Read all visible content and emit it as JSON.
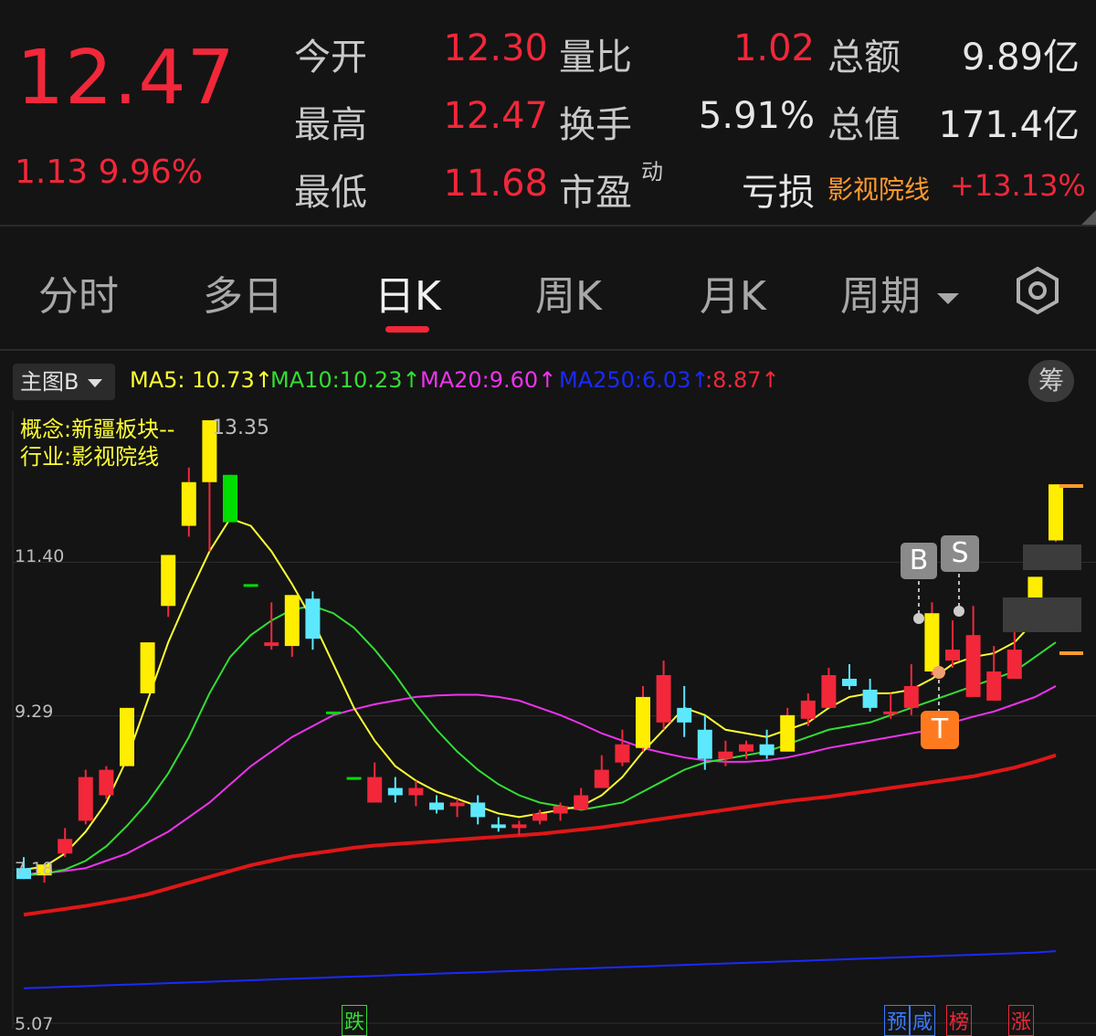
{
  "quote": {
    "price": "12.47",
    "change": "1.13 9.96%",
    "rows": [
      {
        "l1": "今开",
        "v1": "12.30",
        "l2": "量比",
        "v2": "1.02",
        "l3": "总额",
        "v3": "9.89亿"
      },
      {
        "l1": "最高",
        "v1": "12.47",
        "l2": "换手",
        "v2": "5.91%",
        "l3": "总值",
        "v3": "171.4亿"
      },
      {
        "l1": "最低",
        "v1": "11.68",
        "l2": "市盈",
        "v2": "亏损",
        "v2sup": "动",
        "l3": "影视院线",
        "v3": "+13.13%"
      }
    ]
  },
  "tabs": [
    "分时",
    "多日",
    "日K",
    "周K",
    "月K",
    "周期"
  ],
  "active_tab": "日K",
  "chart_toolbar": {
    "main_label": "主图B",
    "ma5": "MA5: 10.73↑",
    "ma10": "MA10:10.23↑",
    "ma20": "MA20:9.60↑",
    "ma250": "MA250:6.03↑",
    "extra": ":8.87↑",
    "chou": "筹"
  },
  "concept": {
    "line1": "概念:新疆板块--",
    "line2": "行业:影视院线"
  },
  "markers": {
    "high": "13.35",
    "b": "B",
    "s": "S",
    "t": "T",
    "die": "跌",
    "yu": "预",
    "xian": "咸",
    "bang": "榜",
    "zhang": "涨"
  },
  "colors": {
    "up": "#f2273a",
    "down": "#5ce8ff",
    "ma5": "#ffff33",
    "ma10": "#33dd33",
    "ma20": "#ee33ee",
    "ma250": "#1a2aff",
    "ma_red": "#e01616",
    "limit_up": "#ffee00",
    "limit_down": "#00dd00"
  },
  "chart_data": {
    "type": "candlestick",
    "ylabels": [
      "11.40",
      "9.29",
      "7.18",
      "5.07"
    ],
    "ylim": [
      5.07,
      13.35
    ],
    "candles": [
      {
        "o": 7.2,
        "h": 7.35,
        "l": 7.05,
        "c": 7.05
      },
      {
        "o": 7.1,
        "h": 7.25,
        "l": 7.0,
        "c": 7.25,
        "limit": true
      },
      {
        "o": 7.4,
        "h": 7.75,
        "l": 7.35,
        "c": 7.6
      },
      {
        "o": 7.85,
        "h": 8.55,
        "l": 7.8,
        "c": 8.45
      },
      {
        "o": 8.2,
        "h": 8.6,
        "l": 8.15,
        "c": 8.55
      },
      {
        "o": 8.6,
        "h": 9.4,
        "l": 8.6,
        "c": 9.4,
        "limit": true
      },
      {
        "o": 9.6,
        "h": 10.3,
        "l": 9.6,
        "c": 10.3,
        "limit": true
      },
      {
        "o": 10.8,
        "h": 11.5,
        "l": 10.65,
        "c": 11.5,
        "limit": true
      },
      {
        "o": 12.5,
        "h": 12.7,
        "l": 11.75,
        "c": 11.9,
        "limit": true
      },
      {
        "o": 12.5,
        "h": 13.35,
        "l": 11.55,
        "c": 13.35,
        "limit": true
      },
      {
        "o": 12.6,
        "h": 12.6,
        "l": 11.95,
        "c": 11.95,
        "fall": true
      },
      {
        "o": 11.1,
        "h": 11.1,
        "l": 11.1,
        "c": 11.1,
        "fall": true
      },
      {
        "o": 10.25,
        "h": 10.85,
        "l": 10.2,
        "c": 10.3
      },
      {
        "o": 10.25,
        "h": 10.95,
        "l": 10.1,
        "c": 10.95,
        "limit": true
      },
      {
        "o": 10.9,
        "h": 11.0,
        "l": 10.2,
        "c": 10.35
      },
      {
        "o": 9.35,
        "h": 9.35,
        "l": 9.35,
        "c": 9.35,
        "fall": true
      },
      {
        "o": 8.45,
        "h": 8.45,
        "l": 8.45,
        "c": 8.45,
        "fall": true
      },
      {
        "o": 8.1,
        "h": 8.65,
        "l": 8.1,
        "c": 8.45
      },
      {
        "o": 8.3,
        "h": 8.45,
        "l": 8.1,
        "c": 8.2
      },
      {
        "o": 8.2,
        "h": 8.4,
        "l": 8.05,
        "c": 8.3
      },
      {
        "o": 8.1,
        "h": 8.2,
        "l": 7.95,
        "c": 8.0
      },
      {
        "o": 8.05,
        "h": 8.15,
        "l": 7.9,
        "c": 8.1
      },
      {
        "o": 8.1,
        "h": 8.2,
        "l": 7.8,
        "c": 7.9
      },
      {
        "o": 7.8,
        "h": 7.9,
        "l": 7.7,
        "c": 7.75
      },
      {
        "o": 7.75,
        "h": 7.85,
        "l": 7.65,
        "c": 7.8
      },
      {
        "o": 7.85,
        "h": 8.0,
        "l": 7.8,
        "c": 7.95
      },
      {
        "o": 7.95,
        "h": 8.1,
        "l": 7.85,
        "c": 8.05
      },
      {
        "o": 8.0,
        "h": 8.3,
        "l": 8.0,
        "c": 8.2
      },
      {
        "o": 8.3,
        "h": 8.75,
        "l": 8.3,
        "c": 8.55
      },
      {
        "o": 8.65,
        "h": 9.1,
        "l": 8.6,
        "c": 8.9
      },
      {
        "o": 8.85,
        "h": 9.7,
        "l": 8.8,
        "c": 9.55,
        "limit": true
      },
      {
        "o": 9.2,
        "h": 10.05,
        "l": 9.1,
        "c": 9.85
      },
      {
        "o": 9.4,
        "h": 9.7,
        "l": 9.0,
        "c": 9.2
      },
      {
        "o": 9.1,
        "h": 9.3,
        "l": 8.55,
        "c": 8.7
      },
      {
        "o": 8.7,
        "h": 8.95,
        "l": 8.6,
        "c": 8.8
      },
      {
        "o": 8.8,
        "h": 8.95,
        "l": 8.7,
        "c": 8.9
      },
      {
        "o": 8.9,
        "h": 9.1,
        "l": 8.7,
        "c": 8.75
      },
      {
        "o": 8.8,
        "h": 9.4,
        "l": 8.8,
        "c": 9.3,
        "limit": true
      },
      {
        "o": 9.25,
        "h": 9.6,
        "l": 9.15,
        "c": 9.5
      },
      {
        "o": 9.4,
        "h": 9.95,
        "l": 9.4,
        "c": 9.85
      },
      {
        "o": 9.8,
        "h": 10.0,
        "l": 9.65,
        "c": 9.7
      },
      {
        "o": 9.65,
        "h": 9.8,
        "l": 9.35,
        "c": 9.4
      },
      {
        "o": 9.35,
        "h": 9.6,
        "l": 9.25,
        "c": 9.35
      },
      {
        "o": 9.4,
        "h": 10.0,
        "l": 9.3,
        "c": 9.7
      },
      {
        "o": 9.9,
        "h": 10.85,
        "l": 9.85,
        "c": 10.7,
        "limit": true
      },
      {
        "o": 10.05,
        "h": 10.6,
        "l": 9.95,
        "c": 10.2
      },
      {
        "o": 9.55,
        "h": 10.8,
        "l": 9.55,
        "c": 10.4
      },
      {
        "o": 9.5,
        "h": 10.25,
        "l": 9.5,
        "c": 9.9
      },
      {
        "o": 9.8,
        "h": 10.5,
        "l": 9.8,
        "c": 10.2
      },
      {
        "o": 10.8,
        "h": 11.2,
        "l": 10.8,
        "c": 11.2,
        "limit": true
      },
      {
        "o": 11.7,
        "h": 12.47,
        "l": 11.68,
        "c": 12.47,
        "limit": true
      }
    ],
    "ma5": [
      7.18,
      7.22,
      7.4,
      7.7,
      8.1,
      8.7,
      9.5,
      10.3,
      10.95,
      11.55,
      12.0,
      11.9,
      11.55,
      11.1,
      10.6,
      10.0,
      9.4,
      8.95,
      8.6,
      8.4,
      8.25,
      8.15,
      8.05,
      7.95,
      7.9,
      7.95,
      8.0,
      8.05,
      8.2,
      8.45,
      8.8,
      9.1,
      9.4,
      9.3,
      9.1,
      9.05,
      9.0,
      9.1,
      9.2,
      9.4,
      9.55,
      9.6,
      9.6,
      9.65,
      9.8,
      10.0,
      10.1,
      10.15,
      10.3,
      10.6,
      10.9
    ],
    "ma10": [
      7.1,
      7.12,
      7.18,
      7.3,
      7.5,
      7.78,
      8.1,
      8.5,
      9.0,
      9.6,
      10.1,
      10.4,
      10.6,
      10.75,
      10.8,
      10.7,
      10.5,
      10.2,
      9.85,
      9.45,
      9.1,
      8.8,
      8.55,
      8.35,
      8.2,
      8.1,
      8.05,
      8.0,
      8.05,
      8.1,
      8.25,
      8.4,
      8.55,
      8.65,
      8.7,
      8.75,
      8.8,
      8.9,
      9.0,
      9.1,
      9.15,
      9.2,
      9.3,
      9.4,
      9.5,
      9.6,
      9.7,
      9.8,
      9.9,
      10.1,
      10.3
    ],
    "ma20": [
      7.12,
      7.13,
      7.16,
      7.2,
      7.3,
      7.4,
      7.55,
      7.7,
      7.9,
      8.1,
      8.35,
      8.6,
      8.8,
      9.0,
      9.15,
      9.3,
      9.38,
      9.45,
      9.5,
      9.55,
      9.57,
      9.58,
      9.58,
      9.55,
      9.5,
      9.4,
      9.3,
      9.18,
      9.05,
      8.95,
      8.85,
      8.78,
      8.72,
      8.68,
      8.66,
      8.66,
      8.68,
      8.72,
      8.78,
      8.85,
      8.9,
      8.95,
      9.0,
      9.05,
      9.1,
      9.2,
      9.28,
      9.35,
      9.45,
      9.55,
      9.7
    ],
    "mared": [
      6.56,
      6.6,
      6.64,
      6.68,
      6.73,
      6.78,
      6.84,
      6.92,
      7.0,
      7.08,
      7.16,
      7.24,
      7.3,
      7.36,
      7.4,
      7.44,
      7.48,
      7.51,
      7.53,
      7.55,
      7.57,
      7.59,
      7.61,
      7.63,
      7.65,
      7.67,
      7.7,
      7.73,
      7.76,
      7.8,
      7.84,
      7.88,
      7.92,
      7.96,
      8.0,
      8.04,
      8.08,
      8.12,
      8.15,
      8.18,
      8.22,
      8.26,
      8.3,
      8.34,
      8.38,
      8.42,
      8.46,
      8.52,
      8.58,
      8.66,
      8.75
    ],
    "ma250": [
      5.55,
      5.56,
      5.57,
      5.58,
      5.59,
      5.6,
      5.61,
      5.62,
      5.63,
      5.64,
      5.65,
      5.66,
      5.67,
      5.68,
      5.69,
      5.7,
      5.71,
      5.72,
      5.73,
      5.74,
      5.75,
      5.76,
      5.77,
      5.78,
      5.79,
      5.8,
      5.81,
      5.82,
      5.83,
      5.84,
      5.85,
      5.86,
      5.87,
      5.88,
      5.89,
      5.9,
      5.91,
      5.92,
      5.93,
      5.94,
      5.95,
      5.96,
      5.97,
      5.98,
      5.99,
      6.0,
      6.01,
      6.02,
      6.03,
      6.04,
      6.06
    ]
  }
}
